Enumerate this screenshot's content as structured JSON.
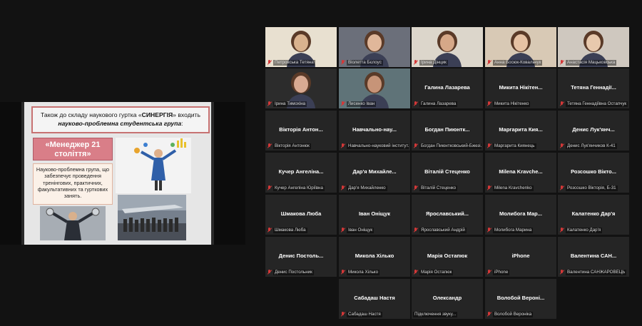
{
  "shared_screen": {
    "header_line1_pre": "Також до складу наукового гуртка «",
    "header_line1_bold": "СИНЕРГІЯ",
    "header_line1_post": "» входить",
    "header_line2": "науково-проблемна студентська група",
    "header_line2_post": ":",
    "box_title": "«Менеджер 21 століття»",
    "box_description": "Науково-проблемна група, що забезпечує проведення тренінгових, практичних, факультативних та гурткових занять."
  },
  "participants": [
    {
      "label": "Петровська Тетяна",
      "video": true,
      "skin": "#d9b28e",
      "bg": "#e8e0d0"
    },
    {
      "label": "Віолетта Бєлоус",
      "video": true,
      "skin": "#e0b79a",
      "bg": "#6b6f7a"
    },
    {
      "label": "Ірина Дінцик",
      "video": true,
      "skin": "#d6a888",
      "bg": "#dcd6cb"
    },
    {
      "label": "Анна Босюк-Ковальчук",
      "video": true,
      "skin": "#e6c2a4",
      "bg": "#d8c9b5"
    },
    {
      "label": "Анастасія Мацьковська",
      "video": true,
      "skin": "#e8c9ad",
      "bg": "#cfc8bf"
    },
    {
      "label": "Ірина Тимохіна",
      "video": true,
      "skin": "#d9aa92",
      "bg": "#2c2c2c",
      "active": true
    },
    {
      "label": "Лисенко Іван",
      "video": true,
      "skin": "#c79478",
      "bg": "#5f7378"
    },
    {
      "name": "Галина Лазарева",
      "label": "Галина Лазарева"
    },
    {
      "name": "Микита Нікітен...",
      "label": "Микита Нікітенко"
    },
    {
      "name": "Тетяна Геннадії...",
      "label": "Тетяна Геннадіївна Остапчук"
    },
    {
      "name": "Вікторія Антон...",
      "label": "Вікторія Антонюк"
    },
    {
      "name": "Навчально-нау...",
      "label": "Навчально-науковий інститут..."
    },
    {
      "name": "Богдан Пиюнтк...",
      "label": "Богдан Пиюнтковський-Бжезі..."
    },
    {
      "name": "Маргарита Кия...",
      "label": "Маргарита Киянець"
    },
    {
      "name": "Денис Лук'янч...",
      "label": "Денис Лук'янчиков К-41"
    },
    {
      "name": "Кучер Ангеліна...",
      "label": "Кучер Ангеліна Юріївна"
    },
    {
      "name": "Дар'я Михайле...",
      "label": "Дар'я Михайленко"
    },
    {
      "name": "Віталій Стеценко",
      "label": "Віталій Стеценко"
    },
    {
      "name": "Milena Kravche...",
      "label": "Milena Kravchenko"
    },
    {
      "name": "Розсошко Вікто...",
      "label": "Розсошко Вікторія, Б-31"
    },
    {
      "name": "Шмакова Люба",
      "label": "Шмакова Люба"
    },
    {
      "name": "Іван Оніщук",
      "label": "Іван Оніщук"
    },
    {
      "name": "Ярославський...",
      "label": "Ярославський Андрій"
    },
    {
      "name": "Молибога Мар...",
      "label": "Молибога Марина"
    },
    {
      "name": "Калатенко Дар'я",
      "label": "Калатенко Дар'я"
    },
    {
      "name": "Денис Постоль...",
      "label": "Денис Постольник"
    },
    {
      "name": "Микола Хілько",
      "label": "Микола Хілько"
    },
    {
      "name": "Марія Остапюк",
      "label": "Марія Остапюк"
    },
    {
      "name": "iPhone",
      "label": "iPhone"
    },
    {
      "name": "Валентина САН...",
      "label": "Валентина САНЖАРОВЕЦЬ"
    },
    {
      "name": "Сабадаш Настя",
      "label": "Сабадаш Настя"
    },
    {
      "name": "Олександр",
      "label": "Підключення звуку...",
      "no_mic": true
    },
    {
      "name": "Волобой Вероні...",
      "label": "Волобой Вероніка"
    }
  ]
}
